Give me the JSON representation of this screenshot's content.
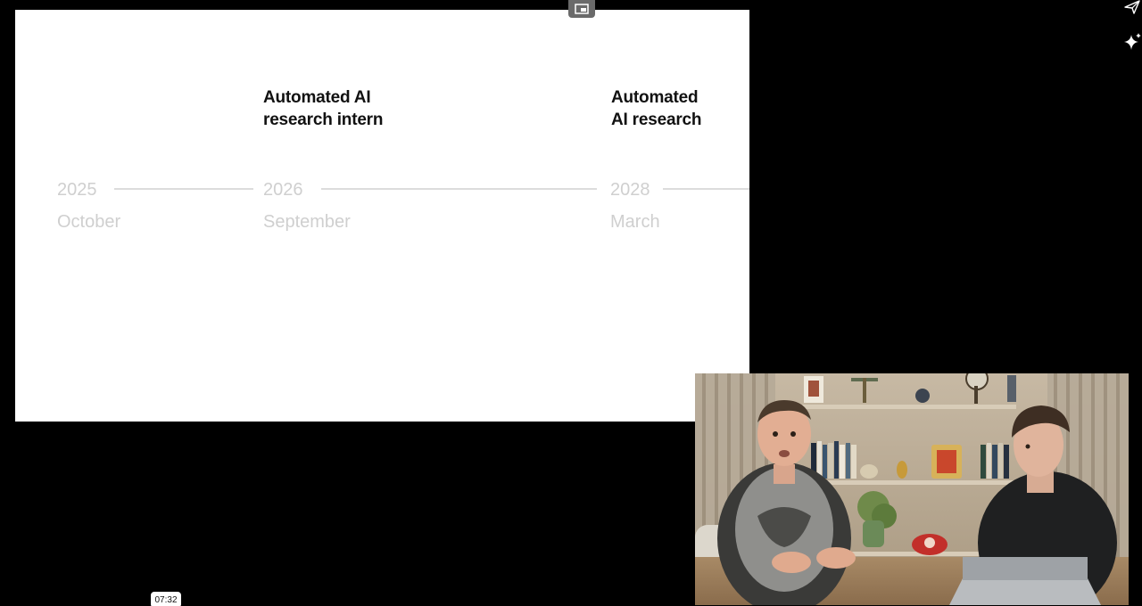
{
  "slide": {
    "milestones": [
      {
        "line1": "Automated AI",
        "line2": "research intern"
      },
      {
        "line1": "Automated",
        "line2": "AI research"
      }
    ],
    "timeline": [
      {
        "year": "2025",
        "month": "October"
      },
      {
        "year": "2026",
        "month": "September"
      },
      {
        "year": "2028",
        "month": "March"
      }
    ]
  },
  "controls": {
    "pip_icon": "picture-in-picture-icon",
    "send_icon": "send-icon",
    "sparkle_icon": "sparkle-icon"
  },
  "player": {
    "timestamp": "07:32"
  },
  "colors": {
    "background": "#000000",
    "slide": "#ffffff",
    "milestone_text": "#111111",
    "timeline_muted": "#cfcfcf"
  }
}
